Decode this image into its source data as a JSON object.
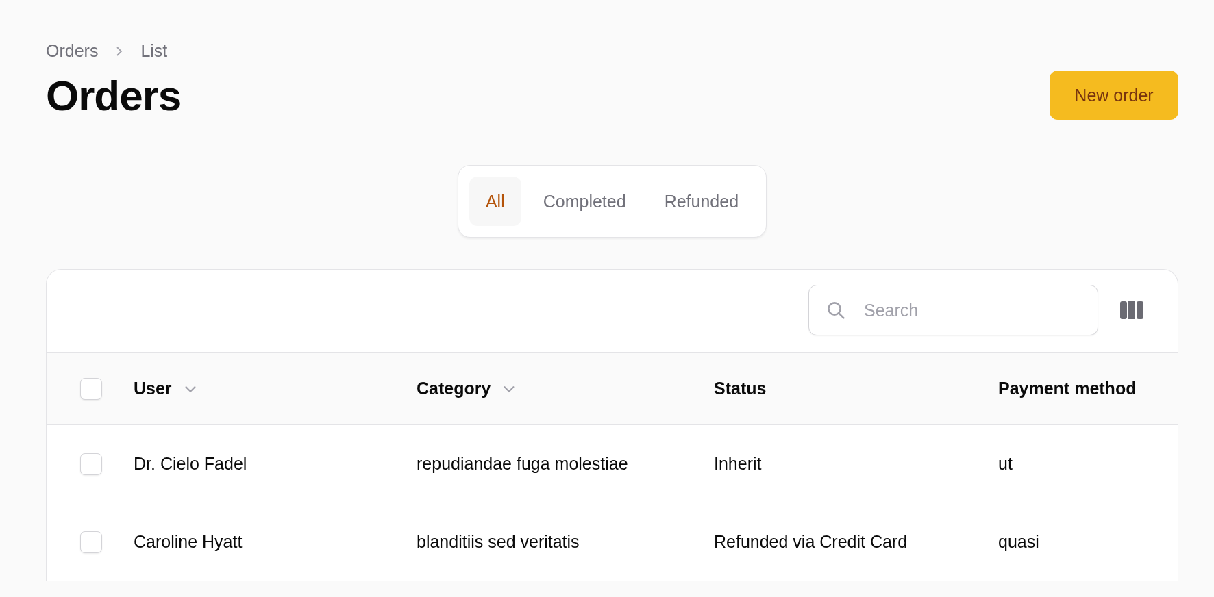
{
  "breadcrumbs": [
    "Orders",
    "List"
  ],
  "title": "Orders",
  "new_button": "New order",
  "tabs": [
    {
      "label": "All",
      "selected": true
    },
    {
      "label": "Completed",
      "selected": false
    },
    {
      "label": "Refunded",
      "selected": false
    }
  ],
  "search": {
    "placeholder": "Search"
  },
  "table": {
    "select_all": {
      "checked": false
    },
    "columns": [
      {
        "label": "User",
        "sortable": true
      },
      {
        "label": "Category",
        "sortable": true
      },
      {
        "label": "Status",
        "sortable": false
      },
      {
        "label": "Payment method",
        "sortable": false
      }
    ],
    "rows": [
      {
        "checked": false,
        "cells": [
          "Dr. Cielo Fadel",
          "repudiandae fuga molestiae",
          "Inherit",
          "ut"
        ]
      },
      {
        "checked": false,
        "cells": [
          "Caroline Hyatt",
          "blanditiis sed veritatis",
          "Refunded via Credit Card",
          "quasi"
        ]
      }
    ]
  }
}
